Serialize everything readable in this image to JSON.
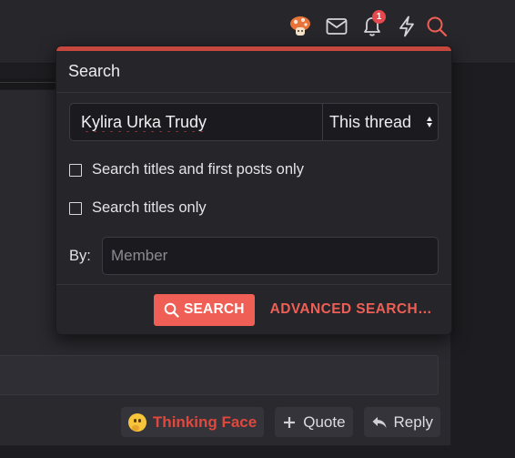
{
  "colors": {
    "accent": "#ef5f55",
    "accent_bar": "#c6473d",
    "panel": "#25252a",
    "page": "#1d1d21",
    "badge": "#e5484d"
  },
  "nav": {
    "icons": [
      "avatar-mushroom-icon",
      "envelope-icon",
      "bell-icon",
      "lightning-icon",
      "search-icon"
    ],
    "alerts_badge": "1"
  },
  "search_menu": {
    "title": "Search",
    "query": "Kylira Urka Trudy",
    "scope": {
      "selected": "This thread",
      "icon": "updown-arrows-icon"
    },
    "options": [
      {
        "label": "Search titles and first posts only",
        "checked": false
      },
      {
        "label": "Search titles only",
        "checked": false
      }
    ],
    "by": {
      "label": "By:",
      "placeholder": "Member",
      "value": ""
    },
    "search_button": "SEARCH",
    "advanced_link": "ADVANCED SEARCH…"
  },
  "post_actions": {
    "reaction": {
      "label": "Thinking Face",
      "icon": "thinking-face-icon"
    },
    "quote": {
      "label": "Quote",
      "icon": "plus-icon"
    },
    "reply": {
      "label": "Reply",
      "icon": "reply-arrow-icon"
    }
  }
}
